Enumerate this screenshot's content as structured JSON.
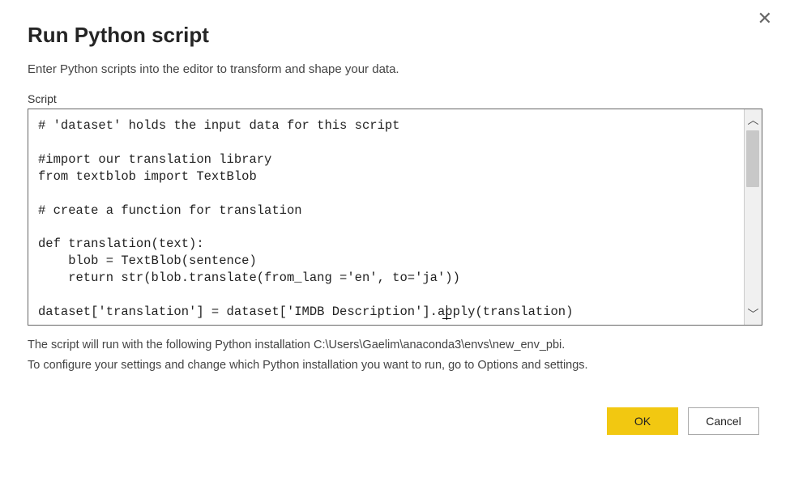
{
  "dialog": {
    "title": "Run Python script",
    "subtitle": "Enter Python scripts into the editor to transform and shape your data.",
    "close_label": "✕"
  },
  "field": {
    "label": "Script"
  },
  "script_content": "# 'dataset' holds the input data for this script\n\n#import our translation library\nfrom textblob import TextBlob\n\n# create a function for translation\n\ndef translation(text):\n    blob = TextBlob(sentence)\n    return str(blob.translate(from_lang ='en', to='ja'))\n\ndataset['translation'] = dataset['IMDB Description'].apply(translation)",
  "info": {
    "line1": "The script will run with the following Python installation C:\\Users\\Gaelim\\anaconda3\\envs\\new_env_pbi.",
    "line2": "To configure your settings and change which Python installation you want to run, go to Options and settings."
  },
  "buttons": {
    "ok": "OK",
    "cancel": "Cancel"
  },
  "scroll": {
    "up": "︿",
    "down": "﹀"
  }
}
